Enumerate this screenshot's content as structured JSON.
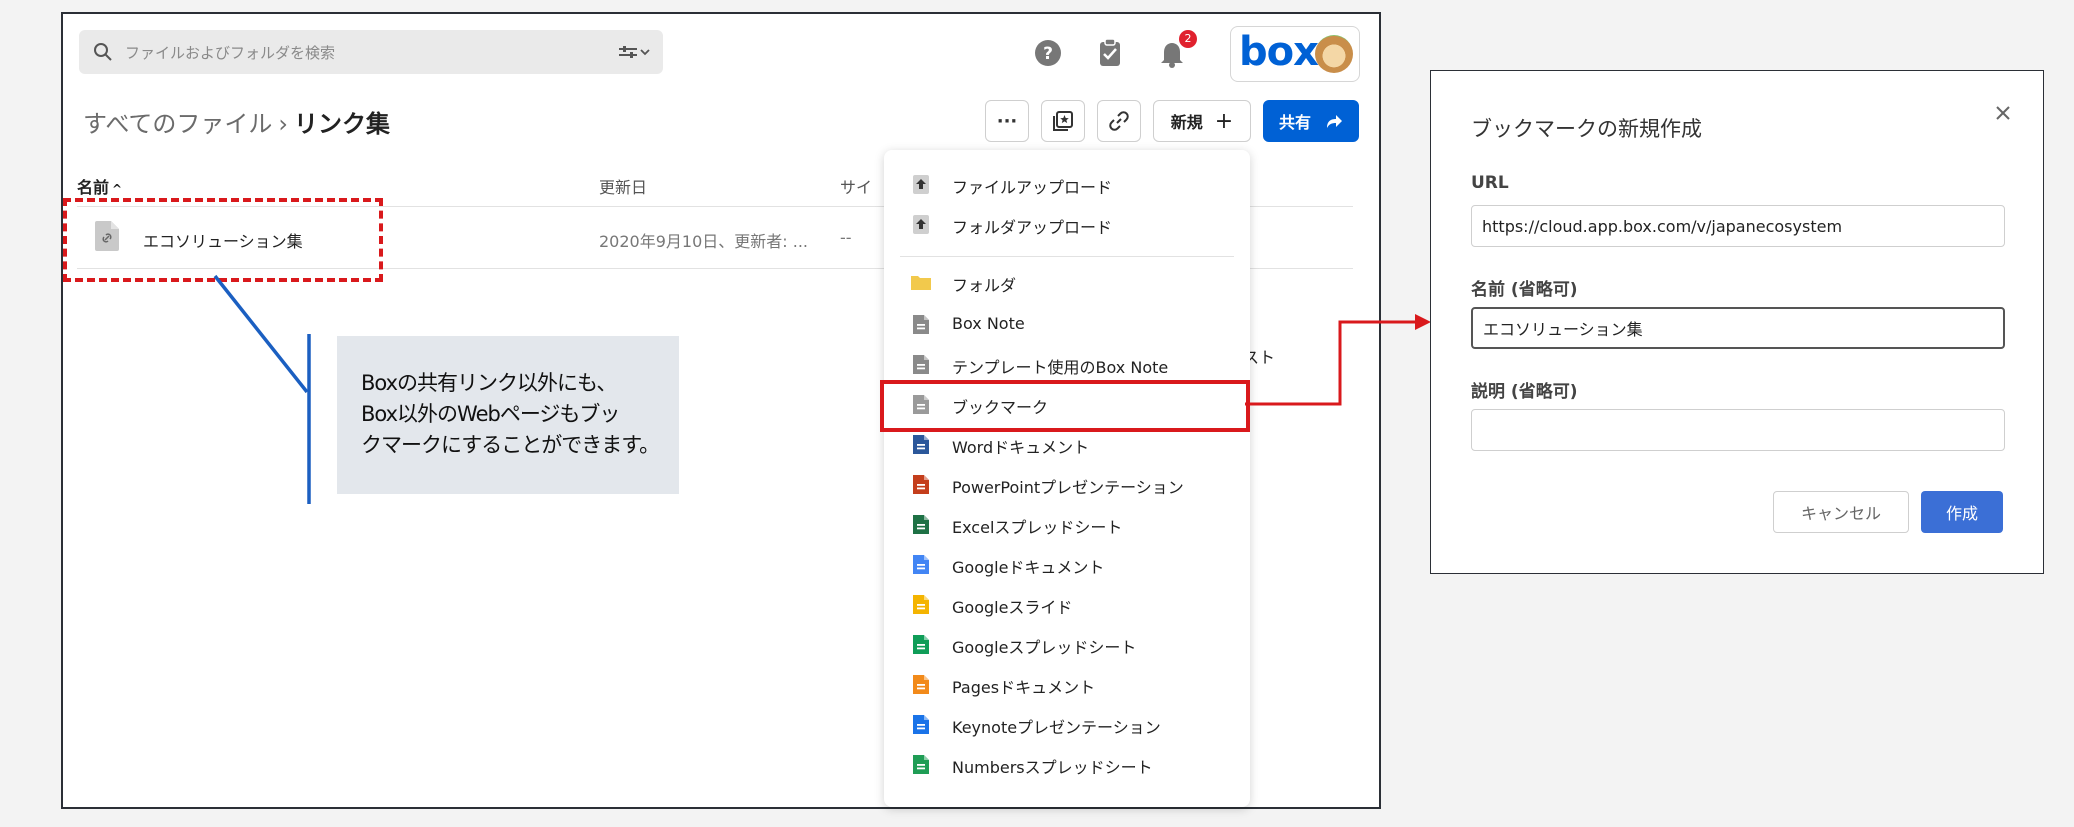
{
  "search": {
    "placeholder": "ファイルおよびフォルダを検索"
  },
  "header": {
    "notification_count": "2",
    "logo_text": "box"
  },
  "breadcrumb": {
    "root": "すべてのファイル",
    "separator": "›",
    "current": "リンク集"
  },
  "toolbar": {
    "more_label": "···",
    "new_label": "新規",
    "new_plus": "+",
    "share_label": "共有"
  },
  "columns": {
    "name": "名前",
    "sort_indicator": "^",
    "updated": "更新日",
    "size": "サイ"
  },
  "file_row": {
    "name": "エコソリューション集",
    "updated": "2020年9月10日、更新者: ...",
    "size": "--"
  },
  "background_peek_text": "スト",
  "callout": {
    "lines": [
      "Boxの共有リンク以外にも、",
      "Box以外のWebページもブッ",
      "クマークにすることができます。"
    ]
  },
  "new_menu": {
    "items": [
      {
        "label": "ファイルアップロード",
        "icon": "file-upload-icon",
        "color": "#555555"
      },
      {
        "label": "フォルダアップロード",
        "icon": "folder-upload-icon",
        "color": "#555555"
      },
      {
        "label": "フォルダ",
        "icon": "folder-icon",
        "color": "#f2c94c"
      },
      {
        "label": "Box Note",
        "icon": "box-note-icon",
        "color": "#8a8a8a"
      },
      {
        "label": "テンプレート使用のBox Note",
        "icon": "box-note-template-icon",
        "color": "#8a8a8a"
      },
      {
        "label": "ブックマーク",
        "icon": "bookmark-icon",
        "color": "#9a9a9a"
      },
      {
        "label": "Wordドキュメント",
        "icon": "word-icon",
        "color": "#2b579a"
      },
      {
        "label": "PowerPointプレゼンテーション",
        "icon": "powerpoint-icon",
        "color": "#c43e1c"
      },
      {
        "label": "Excelスプレッドシート",
        "icon": "excel-icon",
        "color": "#1e7145"
      },
      {
        "label": "Googleドキュメント",
        "icon": "google-docs-icon",
        "color": "#4285f4"
      },
      {
        "label": "Googleスライド",
        "icon": "google-slides-icon",
        "color": "#f4b400"
      },
      {
        "label": "Googleスプレッドシート",
        "icon": "google-sheets-icon",
        "color": "#0f9d58"
      },
      {
        "label": "Pagesドキュメント",
        "icon": "pages-icon",
        "color": "#f28a1a"
      },
      {
        "label": "Keynoteプレゼンテーション",
        "icon": "keynote-icon",
        "color": "#1a73e8"
      },
      {
        "label": "Numbersスプレッドシート",
        "icon": "numbers-icon",
        "color": "#1f9d55"
      }
    ]
  },
  "dialog": {
    "title": "ブックマークの新規作成",
    "url_label": "URL",
    "url_value": "https://cloud.app.box.com/v/japanecosystem",
    "name_label": "名前 (省略可)",
    "name_value": "エコソリューション集",
    "description_label": "説明 (省略可)",
    "description_value": "",
    "cancel_label": "キャンセル",
    "create_label": "作成"
  },
  "colors": {
    "brand_blue": "#0061d5",
    "annotation_red": "#d9191c",
    "annotation_blue": "#1b5fc1",
    "notification_red": "#e0212e"
  }
}
